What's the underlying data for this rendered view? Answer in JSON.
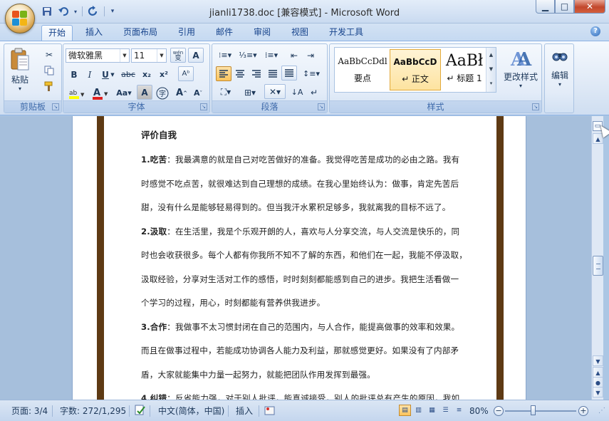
{
  "window": {
    "title": "jianli1738.doc [兼容模式] - Microsoft Word",
    "controls": {
      "minimize": "▁",
      "maximize": "□",
      "close": "✕"
    }
  },
  "qat": {
    "save": "💾",
    "undo": "↶",
    "undo_dd": "▾",
    "redo": "↻",
    "customize": "▾"
  },
  "tabs": [
    "开始",
    "插入",
    "页面布局",
    "引用",
    "邮件",
    "审阅",
    "视图",
    "开发工具"
  ],
  "ribbon": {
    "clipboard": {
      "label": "剪贴板",
      "paste": "粘贴",
      "paste_dd": "▾"
    },
    "font": {
      "label": "字体",
      "font_name": "微软雅黑",
      "font_size": "11",
      "wen": "wén",
      "phonetic_char": "变"
    },
    "paragraph": {
      "label": "段落"
    },
    "styles": {
      "label": "样式",
      "items": [
        {
          "sample": "AaBbCcDdl",
          "name": "要点"
        },
        {
          "sample": "AaBbCcD",
          "name": "↵ 正文"
        },
        {
          "sample": "AaBł",
          "name": "↵ 标题 1"
        }
      ],
      "change_styles": "更改样式"
    },
    "editing": {
      "label": "编辑"
    }
  },
  "document": {
    "heading": "评价自我",
    "lines": [
      {
        "bold": "1.吃苦",
        "text": "：我最满意的就是自己对吃苦做好的准备。我觉得吃苦是成功的必由之路。我有"
      },
      {
        "bold": "",
        "text": "时感觉不吃点苦，就很难达到自己理想的成绩。在我心里始终认为：做事，肯定先苦后"
      },
      {
        "bold": "",
        "text": "甜，没有什么是能够轻易得到的。但当我汗水累积足够多，我就离我的目标不远了。"
      },
      {
        "bold": "2.汲取",
        "text": "：在生活里，我是个乐观开朗的人，喜欢与人分享交流，与人交流是快乐的，同"
      },
      {
        "bold": "",
        "text": "时也会收获很多。每个人都有你我所不知不了解的东西，和他们在一起，我能不停汲取，"
      },
      {
        "bold": "",
        "text": "汲取经验，分享对生活对工作的感悟，时时刻刻都能感到自己的进步。我把生活看做一"
      },
      {
        "bold": "",
        "text": "个学习的过程，用心，时刻都能有营养供我进步。"
      },
      {
        "bold": "3.合作",
        "text": "：我做事不太习惯封闭在自己的范围内，与人合作，能提高做事的效率和效果。"
      },
      {
        "bold": "",
        "text": "而且在做事过程中，若能成功协调各人能力及利益，那就感觉更好。如果没有了内部矛"
      },
      {
        "bold": "",
        "text": "盾，大家就能集中力量一起努力，就能把团队作用发挥到最强。"
      },
      {
        "bold": "4.纠错",
        "text": "：反省能力强，对于别人批评，能真诚接受，别人的批评总有产生的原因，我如"
      }
    ]
  },
  "status": {
    "page": "页面: 3/4",
    "words": "字数: 272/1,295",
    "language": "中文(简体，中国)",
    "mode": "插入",
    "zoom": "80%",
    "zoom_level_percent": 80
  }
}
